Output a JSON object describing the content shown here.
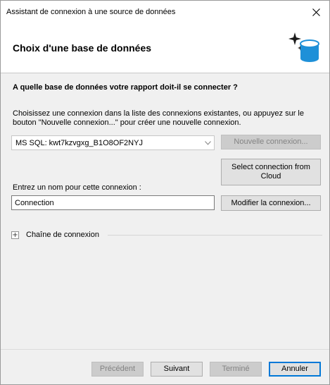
{
  "window": {
    "title": "Assistant de connexion à une source de données",
    "close_icon": "close-icon"
  },
  "header": {
    "title": "Choix d'une base de données",
    "icon": "database-sparkle-icon",
    "icon_color": "#1e90d8"
  },
  "content": {
    "question": "A quelle base de données votre rapport doit-il se connecter ?",
    "instructions": "Choisissez une connexion dans la liste des connexions existantes, ou appuyez sur le bouton \"Nouvelle connexion...\" pour créer une nouvelle connexion.",
    "connection_select": {
      "value": "MS SQL: kwt7kzvgxg_B1O8OF2NYJ"
    },
    "new_connection_label": "Nouvelle connexion...",
    "select_from_cloud_label": "Select connection from Cloud",
    "name_label": "Entrez un nom pour cette connexion :",
    "name_input_value": "Connection",
    "modify_connection_label": "Modifier la connexion...",
    "connection_string_label": "Chaîne de connexion",
    "expander_glyph": "+"
  },
  "footer": {
    "previous_label": "Précédent",
    "next_label": "Suivant",
    "finish_label": "Terminé",
    "cancel_label": "Annuler"
  },
  "colors": {
    "accent": "#0078d7",
    "disabled_text": "#838383"
  }
}
